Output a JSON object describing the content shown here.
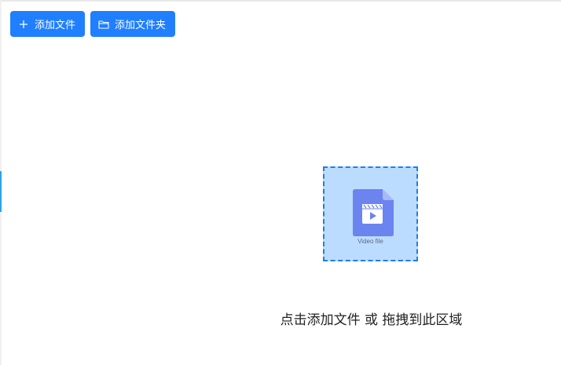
{
  "toolbar": {
    "add_file_label": "添加文件",
    "add_folder_label": "添加文件夹"
  },
  "dropzone": {
    "icon_caption": "Video file",
    "hint": "点击添加文件 或 拖拽到此区域"
  },
  "colors": {
    "primary": "#1f7fff",
    "dropzone_bg": "#bcdcff",
    "dropzone_border": "#1f7fe6",
    "file_icon": "#6b84f0"
  },
  "icons": {
    "add_file": "plus-icon",
    "add_folder": "folder-icon",
    "dropzone": "video-file-icon"
  }
}
